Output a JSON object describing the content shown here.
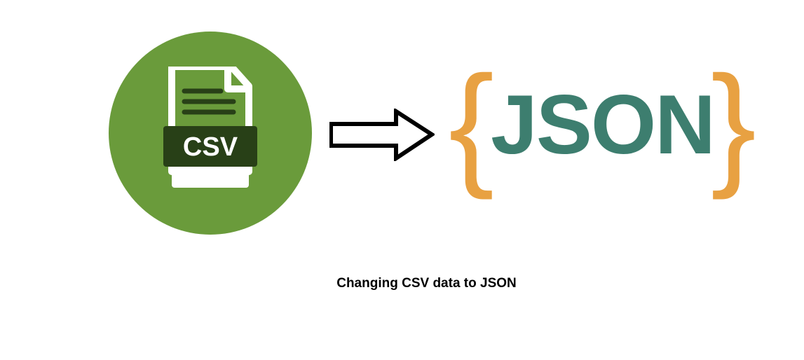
{
  "diagram": {
    "source_label": "CSV",
    "target_label": "JSON",
    "caption": "Changing CSV data to JSON"
  }
}
